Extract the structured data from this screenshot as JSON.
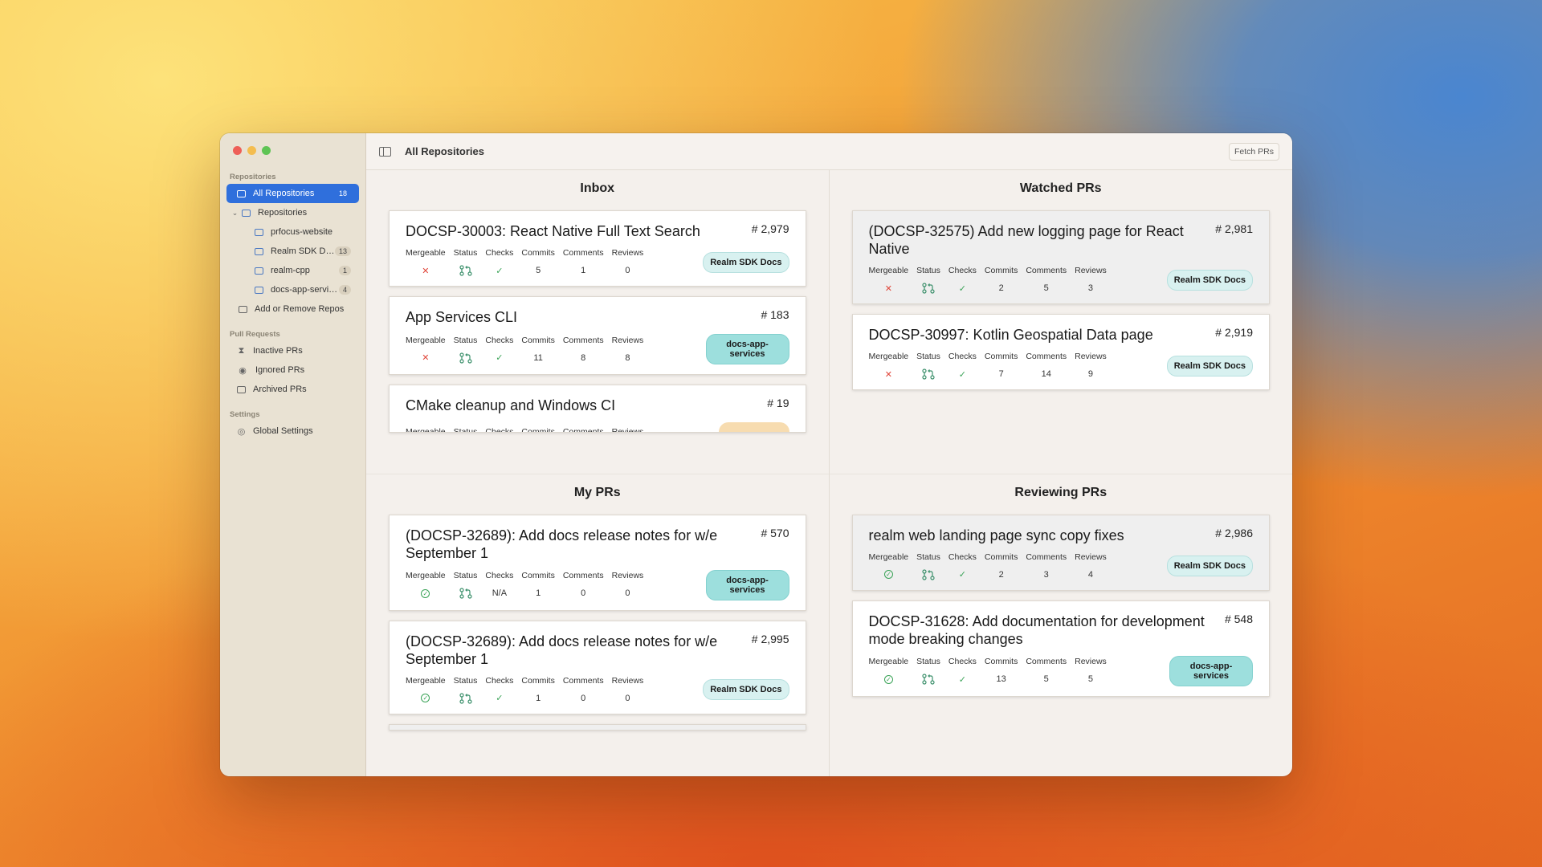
{
  "sidebar": {
    "section_repositories": "Repositories",
    "all_repositories": {
      "label": "All Repositories",
      "count": "18"
    },
    "repositories_group": "Repositories",
    "repos": [
      {
        "label": "prfocus-website",
        "count": ""
      },
      {
        "label": "Realm SDK Docs",
        "count": "13"
      },
      {
        "label": "realm-cpp",
        "count": "1"
      },
      {
        "label": "docs-app-servic...",
        "count": "4"
      }
    ],
    "add_remove": "Add or Remove Repos",
    "section_pull_requests": "Pull Requests",
    "inactive": "Inactive PRs",
    "ignored": "Ignored PRs",
    "archived": "Archived PRs",
    "section_settings": "Settings",
    "global_settings": "Global Settings"
  },
  "toolbar": {
    "title": "All Repositories",
    "fetch": "Fetch PRs"
  },
  "stat_labels": {
    "mergeable": "Mergeable",
    "status": "Status",
    "checks": "Checks",
    "commits": "Commits",
    "comments": "Comments",
    "reviews": "Reviews"
  },
  "quadrants": {
    "inbox": {
      "title": "Inbox",
      "cards": [
        {
          "title": "DOCSP-30003: React Native Full Text Search",
          "number": "# 2,979",
          "checks": "✓",
          "commits": "5",
          "comments": "1",
          "reviews": "0",
          "badge": "Realm SDK Docs"
        },
        {
          "title": "App Services CLI",
          "number": "# 183",
          "checks": "✓",
          "commits": "11",
          "comments": "8",
          "reviews": "8",
          "badge": "docs-app-services"
        },
        {
          "title": "CMake cleanup and Windows CI",
          "number": "# 19"
        }
      ]
    },
    "watched": {
      "title": "Watched PRs",
      "cards": [
        {
          "title": "(DOCSP-32575) Add new logging page for React Native",
          "number": "# 2,981",
          "checks": "✓",
          "commits": "2",
          "comments": "5",
          "reviews": "3",
          "badge": "Realm SDK Docs"
        },
        {
          "title": "DOCSP-30997: Kotlin Geospatial Data page",
          "number": "# 2,919",
          "checks": "✓",
          "commits": "7",
          "comments": "14",
          "reviews": "9",
          "badge": "Realm SDK Docs"
        }
      ]
    },
    "my": {
      "title": "My PRs",
      "cards": [
        {
          "title": "(DOCSP-32689): Add docs release notes for w/e September 1",
          "number": "# 570",
          "checks": "N/A",
          "commits": "1",
          "comments": "0",
          "reviews": "0",
          "badge": "docs-app-services"
        },
        {
          "title": "(DOCSP-32689): Add docs release notes for w/e September 1",
          "number": "# 2,995",
          "checks": "✓",
          "commits": "1",
          "comments": "0",
          "reviews": "0",
          "badge": "Realm SDK Docs"
        }
      ]
    },
    "reviewing": {
      "title": "Reviewing PRs",
      "cards": [
        {
          "title": "realm web landing page sync copy fixes",
          "number": "# 2,986",
          "checks": "✓",
          "commits": "2",
          "comments": "3",
          "reviews": "4",
          "badge": "Realm SDK Docs"
        },
        {
          "title": "DOCSP-31628: Add documentation for development mode breaking changes",
          "number": "# 548",
          "checks": "✓",
          "commits": "13",
          "comments": "5",
          "reviews": "5",
          "badge": "docs-app-services"
        }
      ]
    }
  }
}
